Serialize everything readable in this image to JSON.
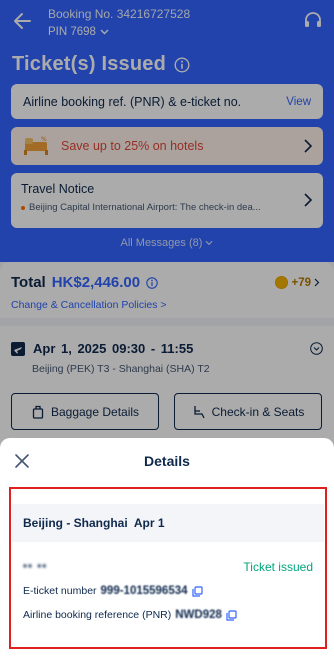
{
  "header": {
    "booking_no": "Booking No. 34216727528",
    "pin": "PIN 7698",
    "title": "Ticket(s) Issued"
  },
  "cards": {
    "pnr_text": "Airline booking ref. (PNR) & e-ticket no.",
    "pnr_view": "View",
    "hotel_promo": "Save up to 25% on hotels",
    "notice_title": "Travel Notice",
    "notice_text": "Beijing Capital International Airport: The check-in dea...",
    "all_messages": "All Messages (8)"
  },
  "summary": {
    "total_label": "Total",
    "total_amount": "HK$2,446.00",
    "coins": "+79",
    "policies": "Change & Cancellation Policies >"
  },
  "flight": {
    "date_time": "Apr 1, 2025   09:30 - 11:55",
    "route": "Beijing (PEK) T3 - Shanghai (SHA) T2",
    "baggage_label": "Baggage Details",
    "checkin_label": "Check-in & Seats"
  },
  "sheet": {
    "title": "Details",
    "segment": "Beijing - Shanghai  Apr 1",
    "passenger": "•• ••",
    "status": "Ticket issued",
    "eticket_label": "E-ticket number",
    "eticket_value": "999-1015596534",
    "pnr_label": "Airline booking reference (PNR)",
    "pnr_value": "NWD928"
  },
  "colors": {
    "brand_blue": "#3264ff",
    "promo_red": "#e0463a",
    "success_green": "#00a67c",
    "highlight_red": "#e01f1f"
  }
}
